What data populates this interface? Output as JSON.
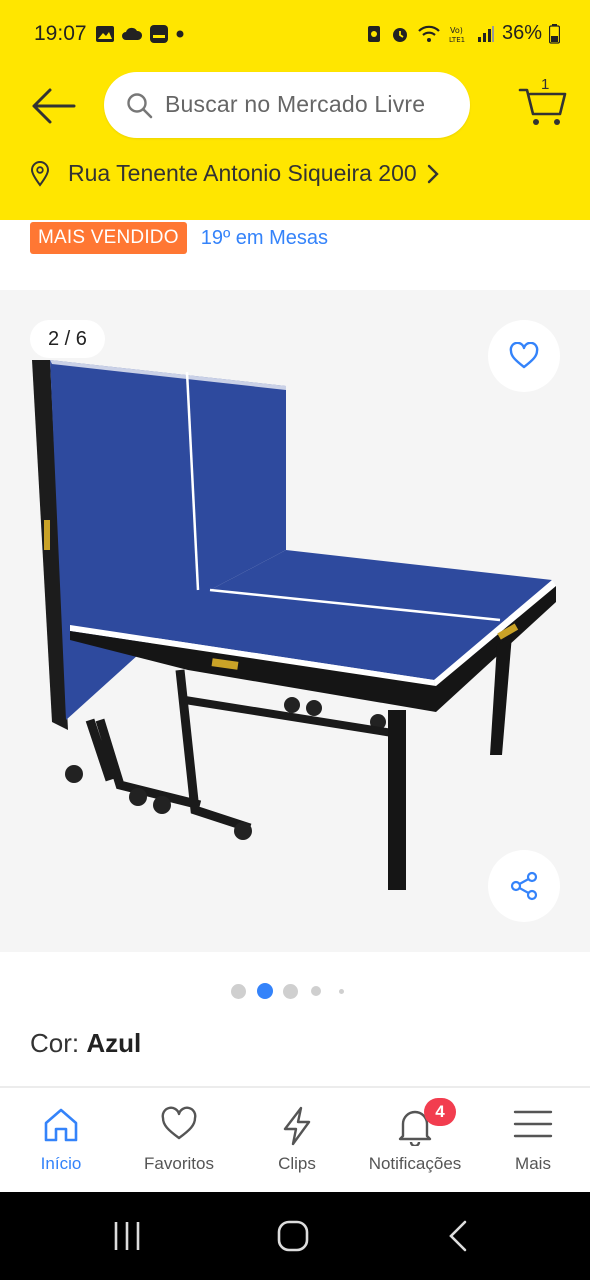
{
  "status_bar": {
    "time": "19:07",
    "battery": "36%"
  },
  "header": {
    "search_placeholder": "Buscar no Mercado Livre",
    "cart_count": "1",
    "address": "Rua Tenente Antonio Siqueira 200"
  },
  "product": {
    "badge": "MAIS VENDIDO",
    "rank": "19º em Mesas",
    "image_counter": "2 / 6",
    "color_label": "Cor:",
    "color_value": "Azul",
    "gallery_dots": 5,
    "gallery_active_index": 1
  },
  "bottom_nav": {
    "items": [
      {
        "label": "Início",
        "icon": "home-icon",
        "active": true
      },
      {
        "label": "Favoritos",
        "icon": "heart-icon"
      },
      {
        "label": "Clips",
        "icon": "lightning-icon"
      },
      {
        "label": "Notificações",
        "icon": "bell-icon",
        "badge": "4"
      },
      {
        "label": "Mais",
        "icon": "hamburger-icon"
      }
    ]
  },
  "colors": {
    "brand_yellow": "#FFE600",
    "accent_blue": "#3483FA",
    "badge_orange": "#FF7733",
    "notification_red": "#F23D4F"
  }
}
